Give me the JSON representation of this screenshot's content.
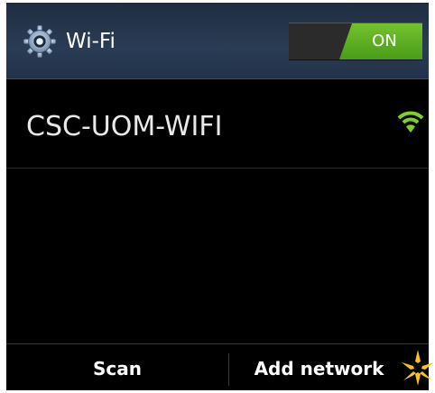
{
  "header": {
    "title": "Wi-Fi",
    "icon": "settings-gear-icon",
    "toggle": {
      "state_label": "ON",
      "on": true
    }
  },
  "networks": [
    {
      "ssid": "CSC-UOM-WIFI",
      "signal_icon": "wifi-signal-icon"
    }
  ],
  "bottom_bar": {
    "scan_label": "Scan",
    "add_network_label": "Add network"
  },
  "colors": {
    "header_bg": "#2a3c55",
    "toggle_on": "#5fae23",
    "wifi_signal": "#7ed321",
    "sparkle": "#f5c518",
    "background": "#000000"
  }
}
